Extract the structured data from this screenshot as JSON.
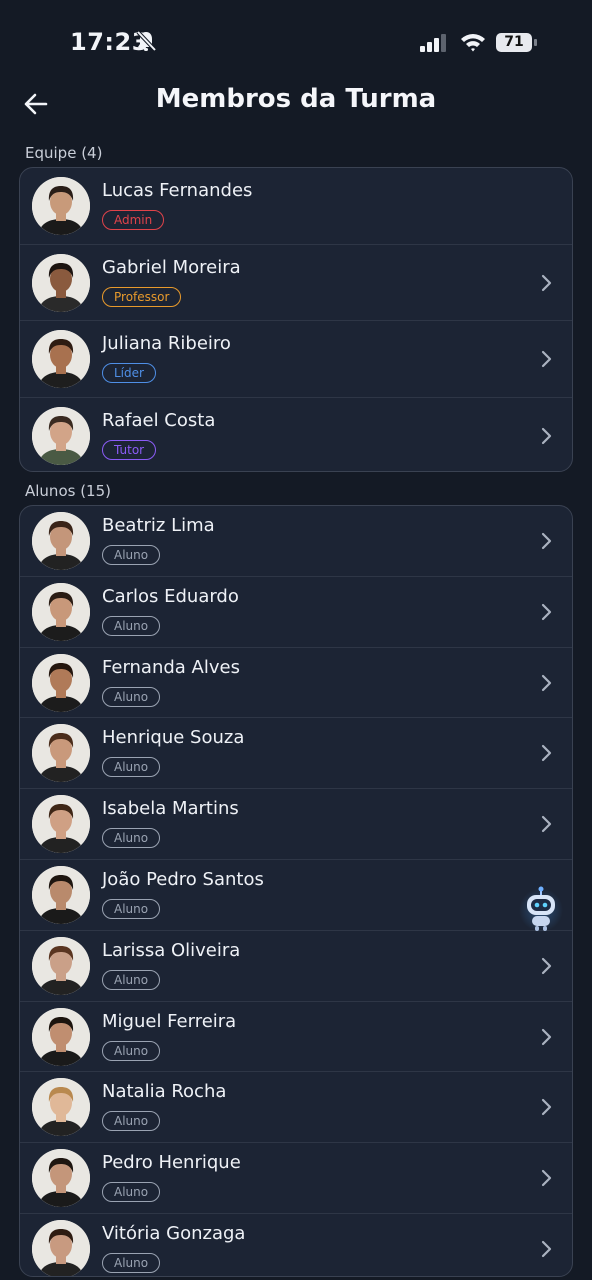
{
  "status_bar": {
    "time": "17:23",
    "battery": "71"
  },
  "header": {
    "title": "Membros da Turma"
  },
  "team": {
    "label": "Equipe (4)",
    "members": [
      {
        "name": "Lucas Fernandes",
        "role": "Admin",
        "role_color": "#e0434a",
        "chevron": false,
        "skin": "#c89a7a",
        "hair": "#2a1e18",
        "shirt": "#1a1a1a"
      },
      {
        "name": "Gabriel Moreira",
        "role": "Professor",
        "role_color": "#e89a2c",
        "chevron": true,
        "skin": "#8a5a3e",
        "hair": "#1c1410",
        "shirt": "#2a2a2a"
      },
      {
        "name": "Juliana Ribeiro",
        "role": "Líder",
        "role_color": "#4f8fe6",
        "chevron": true,
        "skin": "#a8714f",
        "hair": "#2e1c12",
        "shirt": "#1e1e1e"
      },
      {
        "name": "Rafael Costa",
        "role": "Tutor",
        "role_color": "#8b5cf6",
        "chevron": true,
        "skin": "#d2a488",
        "hair": "#3a2a20",
        "shirt": "#4a5a44"
      }
    ]
  },
  "students": {
    "label": "Alunos (15)",
    "members": [
      {
        "name": "Beatriz Lima",
        "role": "Aluno",
        "skin": "#c4967a",
        "hair": "#3a2418",
        "shirt": "#222"
      },
      {
        "name": "Carlos Eduardo",
        "role": "Aluno",
        "skin": "#c8987a",
        "hair": "#2a1c14",
        "shirt": "#1c1c1c"
      },
      {
        "name": "Fernanda Alves",
        "role": "Aluno",
        "skin": "#b07a58",
        "hair": "#24160e",
        "shirt": "#1c1c1c"
      },
      {
        "name": "Henrique Souza",
        "role": "Aluno",
        "skin": "#c9997b",
        "hair": "#4a2c1a",
        "shirt": "#222"
      },
      {
        "name": "Isabela Martins",
        "role": "Aluno",
        "skin": "#cfa084",
        "hair": "#3e2616",
        "shirt": "#222"
      },
      {
        "name": "João Pedro Santos",
        "role": "Aluno",
        "skin": "#b98a6c",
        "hair": "#1e1610",
        "shirt": "#1a1a1a"
      },
      {
        "name": "Larissa Oliveira",
        "role": "Aluno",
        "skin": "#caa088",
        "hair": "#5a3520",
        "shirt": "#222"
      },
      {
        "name": "Miguel Ferreira",
        "role": "Aluno",
        "skin": "#c08e70",
        "hair": "#1c140e",
        "shirt": "#1a1a1a"
      },
      {
        "name": "Natalia Rocha",
        "role": "Aluno",
        "skin": "#e0b898",
        "hair": "#b9894f",
        "shirt": "#222"
      },
      {
        "name": "Pedro Henrique",
        "role": "Aluno",
        "skin": "#c4967a",
        "hair": "#1e1610",
        "shirt": "#1a1a1a"
      },
      {
        "name": "Vitória Gonzaga",
        "role": "Aluno",
        "skin": "#c89a80",
        "hair": "#2e1c12",
        "shirt": "#222"
      }
    ]
  },
  "colors": {
    "background": "#141a25",
    "card": "#1c2434",
    "student_badge": "#9aa3b2"
  },
  "icons": {
    "back": "arrow-left-icon",
    "chevron": "chevron-right-icon",
    "assistant": "robot-icon"
  }
}
